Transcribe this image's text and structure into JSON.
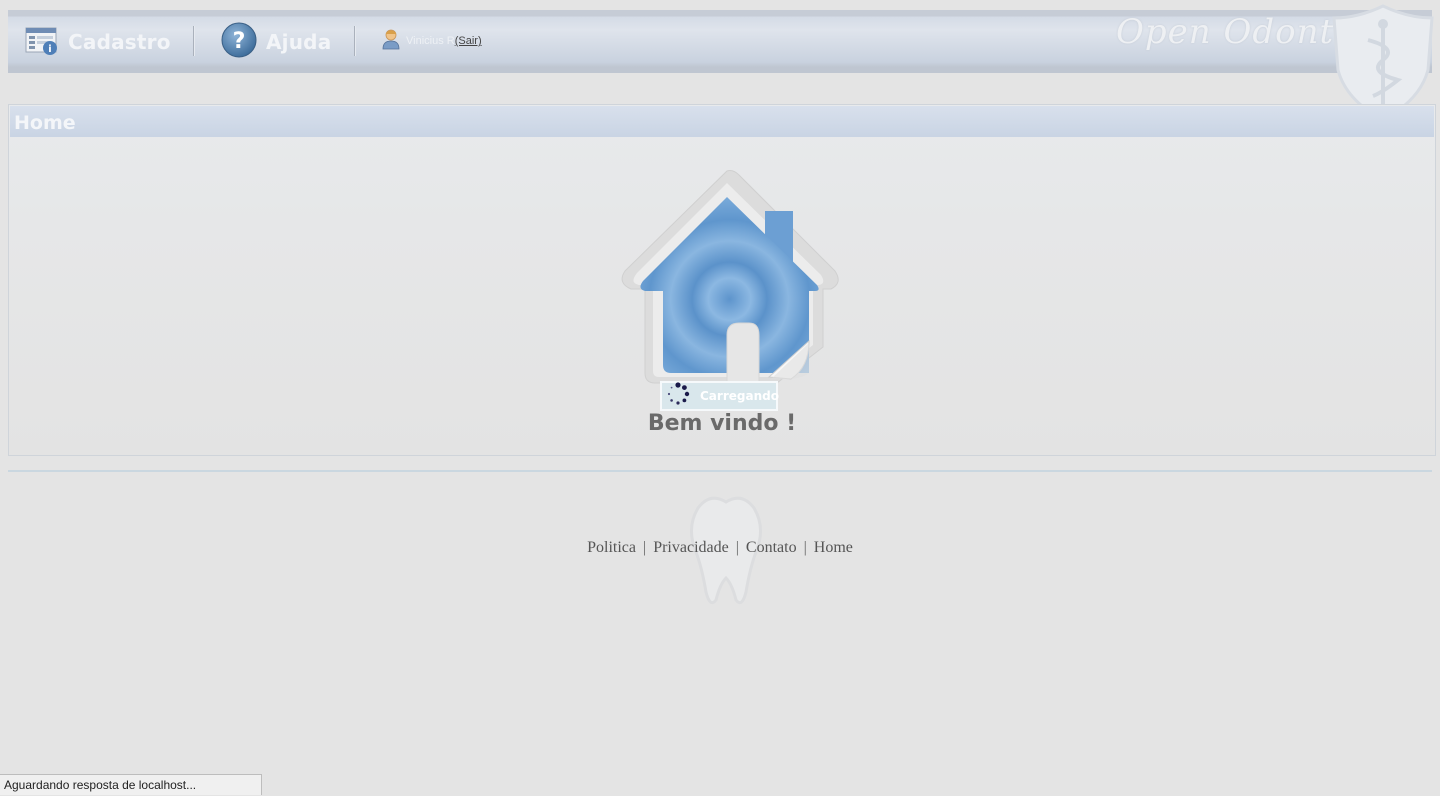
{
  "header": {
    "menu": [
      {
        "label": "Cadastro",
        "icon": "registration-form-icon"
      },
      {
        "label": "Ajuda",
        "icon": "help-icon"
      }
    ],
    "user": {
      "name": "Vinicius R",
      "logout_label": "(Sair)",
      "icon": "user-icon"
    },
    "brand": "Open Odonto",
    "brand_emblem": "caduceus-shield-icon"
  },
  "panel": {
    "title": "Home",
    "icon": "home-icon",
    "loading_text": "Carregando",
    "welcome": "Bem vindo !"
  },
  "footer": {
    "links": [
      "Politica",
      "Privacidade",
      "Contato",
      "Home"
    ],
    "separator": "|",
    "watermark_icon": "tooth-icon"
  },
  "status_bar": {
    "text": "Aguardando resposta de localhost..."
  },
  "colors": {
    "background": "#e4e4e4",
    "header_bar": "#c9d2df",
    "panel_title_bar": "#c9d4e4",
    "house_blue": "#6a9fd4",
    "welcome_text": "#6a6a6a"
  }
}
